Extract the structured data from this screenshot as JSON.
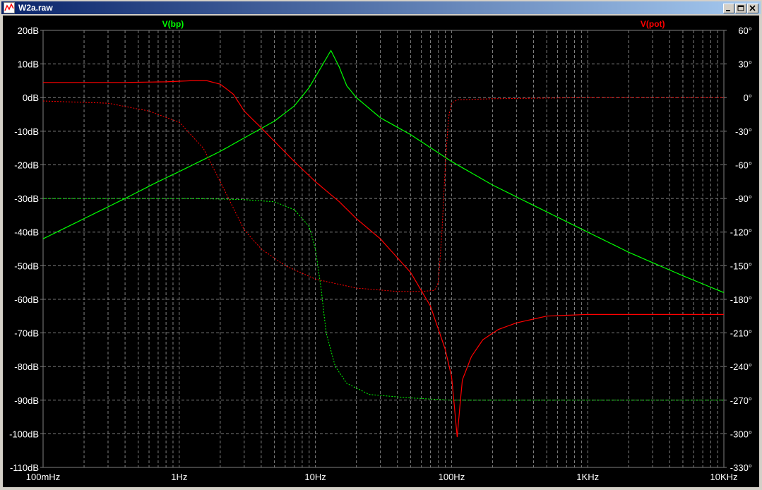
{
  "window": {
    "title": "W2a.raw",
    "controls": {
      "minimize_icon": "minimize-icon",
      "restore_icon": "restore-icon",
      "close_icon": "close-icon"
    }
  },
  "chart_data": {
    "type": "line",
    "title": "",
    "xlabel": "",
    "ylabel": "",
    "x_scale": "log",
    "x_unit": "Hz",
    "xlim": [
      0.1,
      10000
    ],
    "x_ticks": [
      {
        "value": 0.1,
        "label": "100mHz"
      },
      {
        "value": 1,
        "label": "1Hz"
      },
      {
        "value": 10,
        "label": "10Hz"
      },
      {
        "value": 100,
        "label": "100Hz"
      },
      {
        "value": 1000,
        "label": "1KHz"
      },
      {
        "value": 10000,
        "label": "10KHz"
      }
    ],
    "y_left": {
      "unit": "dB",
      "lim": [
        -110,
        20
      ],
      "ticks": [
        {
          "value": 20,
          "label": "20dB"
        },
        {
          "value": 10,
          "label": "10dB"
        },
        {
          "value": 0,
          "label": "0dB"
        },
        {
          "value": -10,
          "label": "-10dB"
        },
        {
          "value": -20,
          "label": "-20dB"
        },
        {
          "value": -30,
          "label": "-30dB"
        },
        {
          "value": -40,
          "label": "-40dB"
        },
        {
          "value": -50,
          "label": "-50dB"
        },
        {
          "value": -60,
          "label": "-60dB"
        },
        {
          "value": -70,
          "label": "-70dB"
        },
        {
          "value": -80,
          "label": "-80dB"
        },
        {
          "value": -90,
          "label": "-90dB"
        },
        {
          "value": -100,
          "label": "-100dB"
        },
        {
          "value": -110,
          "label": "-110dB"
        }
      ]
    },
    "y_right": {
      "unit": "degrees",
      "lim": [
        -330,
        60
      ],
      "ticks": [
        {
          "value": 60,
          "label": "60°"
        },
        {
          "value": 30,
          "label": "30°"
        },
        {
          "value": 0,
          "label": "0°"
        },
        {
          "value": -30,
          "label": "-30°"
        },
        {
          "value": -60,
          "label": "-60°"
        },
        {
          "value": -90,
          "label": "-90°"
        },
        {
          "value": -120,
          "label": "-120°"
        },
        {
          "value": -150,
          "label": "-150°"
        },
        {
          "value": -180,
          "label": "-180°"
        },
        {
          "value": -210,
          "label": "-210°"
        },
        {
          "value": -240,
          "label": "-240°"
        },
        {
          "value": -270,
          "label": "-270°"
        },
        {
          "value": -300,
          "label": "-300°"
        },
        {
          "value": -330,
          "label": "-330°"
        }
      ]
    },
    "grid": true,
    "grid_style": "dashed",
    "legend_placement": "top",
    "colors": {
      "background": "#000000",
      "grid": "#808080",
      "axis_text": "#ffffff",
      "green": "#00ff00",
      "red": "#ff0000"
    },
    "series": [
      {
        "name": "V(bp)",
        "color": "#00ff00",
        "label_anchor_x": 0.9,
        "magnitude_db": [
          [
            0.1,
            -42
          ],
          [
            0.2,
            -36
          ],
          [
            0.4,
            -30
          ],
          [
            0.7,
            -25
          ],
          [
            1,
            -22
          ],
          [
            2,
            -16
          ],
          [
            3,
            -12
          ],
          [
            5,
            -7
          ],
          [
            7,
            -2.5
          ],
          [
            9,
            3
          ],
          [
            11,
            9
          ],
          [
            13,
            14
          ],
          [
            15,
            9
          ],
          [
            17,
            3.5
          ],
          [
            20,
            0
          ],
          [
            30,
            -6
          ],
          [
            50,
            -11
          ],
          [
            100,
            -19
          ],
          [
            200,
            -26
          ],
          [
            500,
            -34
          ],
          [
            1000,
            -40
          ],
          [
            2000,
            -46
          ],
          [
            5000,
            -53
          ],
          [
            10000,
            -58
          ]
        ],
        "phase_deg": [
          [
            0.1,
            -90
          ],
          [
            0.5,
            -90
          ],
          [
            1,
            -90
          ],
          [
            2,
            -90.5
          ],
          [
            3,
            -91
          ],
          [
            5,
            -93
          ],
          [
            7,
            -100
          ],
          [
            9,
            -115
          ],
          [
            10,
            -135
          ],
          [
            11,
            -170
          ],
          [
            12,
            -210
          ],
          [
            14,
            -240
          ],
          [
            17,
            -255
          ],
          [
            25,
            -265
          ],
          [
            50,
            -268
          ],
          [
            100,
            -270
          ],
          [
            1000,
            -270
          ],
          [
            10000,
            -270
          ]
        ]
      },
      {
        "name": "V(pot)",
        "color": "#ff0000",
        "label_anchor_x": 3000,
        "magnitude_db": [
          [
            0.1,
            4.5
          ],
          [
            0.4,
            4.5
          ],
          [
            0.8,
            4.7
          ],
          [
            1.2,
            5
          ],
          [
            1.6,
            5
          ],
          [
            2,
            4
          ],
          [
            2.5,
            1
          ],
          [
            3,
            -4
          ],
          [
            4,
            -9
          ],
          [
            5,
            -13
          ],
          [
            7,
            -19
          ],
          [
            10,
            -25
          ],
          [
            15,
            -31
          ],
          [
            20,
            -36
          ],
          [
            30,
            -42
          ],
          [
            50,
            -52
          ],
          [
            70,
            -62
          ],
          [
            90,
            -75
          ],
          [
            100,
            -83
          ],
          [
            105,
            -92
          ],
          [
            110,
            -101
          ],
          [
            115,
            -92
          ],
          [
            120,
            -84
          ],
          [
            140,
            -77
          ],
          [
            170,
            -72
          ],
          [
            220,
            -69
          ],
          [
            300,
            -67
          ],
          [
            500,
            -65
          ],
          [
            1000,
            -64.5
          ],
          [
            10000,
            -64.5
          ]
        ],
        "phase_deg": [
          [
            0.1,
            -3
          ],
          [
            0.3,
            -5
          ],
          [
            0.6,
            -12
          ],
          [
            1,
            -22
          ],
          [
            1.5,
            -45
          ],
          [
            2,
            -75
          ],
          [
            3,
            -118
          ],
          [
            4,
            -135
          ],
          [
            6,
            -150
          ],
          [
            10,
            -162
          ],
          [
            20,
            -170
          ],
          [
            40,
            -173
          ],
          [
            60,
            -173
          ],
          [
            75,
            -172
          ],
          [
            80,
            -165
          ],
          [
            85,
            -120
          ],
          [
            90,
            -60
          ],
          [
            95,
            -18
          ],
          [
            100,
            -5
          ],
          [
            110,
            -2
          ],
          [
            200,
            -1
          ],
          [
            1000,
            0
          ],
          [
            10000,
            0
          ]
        ]
      }
    ]
  }
}
